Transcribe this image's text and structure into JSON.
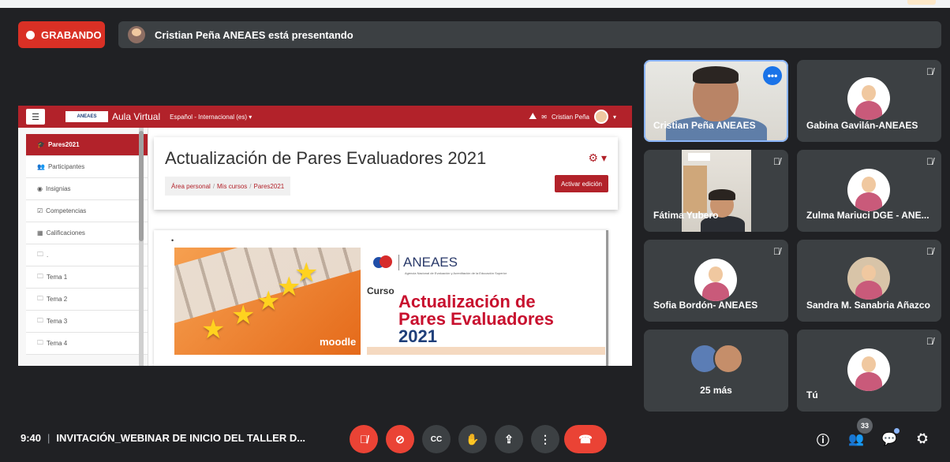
{
  "recording": {
    "label": "GRABANDO"
  },
  "presenting": {
    "text": "Cristian Peña ANEAES está presentando"
  },
  "moodle": {
    "menu_icon": "hamburger-icon",
    "logo_text": "ANEAES",
    "site_name": "Aula Virtual",
    "language": "Español - Internacional (es) ▾",
    "user_name": "Cristian Peña",
    "sidebar": [
      {
        "label": "Pares2021",
        "icon": "graduation-cap-icon",
        "glyph": "🎓"
      },
      {
        "label": "Participantes",
        "icon": "users-icon",
        "glyph": "👥"
      },
      {
        "label": "Insignias",
        "icon": "shield-icon",
        "glyph": "◉"
      },
      {
        "label": "Competencias",
        "icon": "check-square-icon",
        "glyph": "☑"
      },
      {
        "label": "Calificaciones",
        "icon": "table-icon",
        "glyph": "▦"
      },
      {
        "label": ".",
        "icon": "folder-icon",
        "glyph": "🗀"
      },
      {
        "label": "Tema 1",
        "icon": "folder-icon",
        "glyph": "🗀"
      },
      {
        "label": "Tema 2",
        "icon": "folder-icon",
        "glyph": "🗀"
      },
      {
        "label": "Tema 3",
        "icon": "folder-icon",
        "glyph": "🗀"
      },
      {
        "label": "Tema 4",
        "icon": "folder-icon",
        "glyph": "🗀"
      }
    ],
    "course_title": "Actualización de Pares Evaluadores 2021",
    "breadcrumb": [
      "Área personal",
      "Mis cursos",
      "Pares2021"
    ],
    "edit_button": "Activar edición",
    "gear": "⚙ ▾",
    "banner": {
      "brand": "ANEAES",
      "brand_sub": "Agencia Nacional de Evaluación y Acreditación de la Educación Superior",
      "curso": "Curso",
      "line1": "Actualización de",
      "line2": "Pares Evaluadores",
      "line3": "2021",
      "moodle": "moodle"
    }
  },
  "participants": [
    {
      "name": "Cristian Peña ANEAES"
    },
    {
      "name": "Gabina Gavilán-ANEAES"
    },
    {
      "name": "Fátima Yubero"
    },
    {
      "name": "Zulma Mariuci DGE - ANE..."
    },
    {
      "name": "Sofia Bordón- ANEAES"
    },
    {
      "name": "Sandra M. Sanabria Añazco"
    },
    {
      "name": "25 más"
    },
    {
      "name": "Tú"
    }
  ],
  "meeting": {
    "time": "9:40",
    "title": "INVITACIÓN_WEBINAR DE INICIO DEL TALLER D..."
  },
  "controls": [
    {
      "name": "mic-off-icon",
      "glyph": "🎙̸"
    },
    {
      "name": "camera-off-icon",
      "glyph": "⊘"
    },
    {
      "name": "captions-icon",
      "glyph": "CC"
    },
    {
      "name": "raise-hand-icon",
      "glyph": "✋"
    },
    {
      "name": "present-icon",
      "glyph": "⇪"
    },
    {
      "name": "more-options-icon",
      "glyph": "⋮"
    },
    {
      "name": "hang-up-icon",
      "glyph": "☎"
    }
  ],
  "right_controls": {
    "info": "ⓘ",
    "people_count": "33",
    "people": "👥",
    "chat": "💬",
    "activities": "⛭"
  }
}
